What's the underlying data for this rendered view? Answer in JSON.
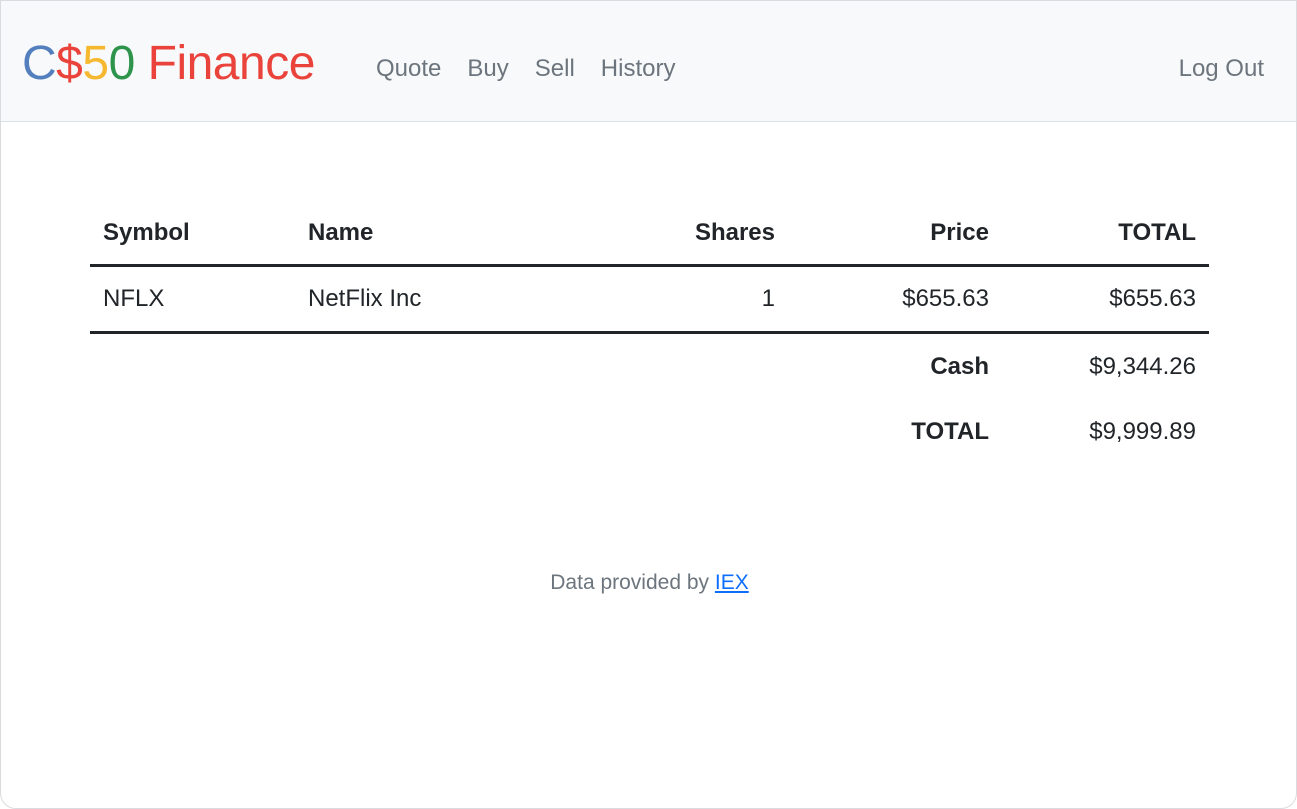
{
  "brand": {
    "parts": [
      {
        "text": "C",
        "color": "#537fbe"
      },
      {
        "text": "$",
        "color": "#ea433b"
      },
      {
        "text": "5",
        "color": "#f5b82e"
      },
      {
        "text": "0",
        "color": "#2e944b"
      },
      {
        "text": " Finance",
        "color": "#ea433b"
      }
    ]
  },
  "nav": {
    "links": [
      "Quote",
      "Buy",
      "Sell",
      "History"
    ],
    "logout": "Log Out"
  },
  "table": {
    "headers": [
      "Symbol",
      "Name",
      "Shares",
      "Price",
      "TOTAL"
    ],
    "rows": [
      {
        "symbol": "NFLX",
        "name": "NetFlix Inc",
        "shares": "1",
        "price": "$655.63",
        "total": "$655.63"
      }
    ],
    "cash_label": "Cash",
    "cash_value": "$9,344.26",
    "grand_total_label": "TOTAL",
    "grand_total_value": "$9,999.89"
  },
  "footer": {
    "text": "Data provided by",
    "link_label": "IEX"
  },
  "colors": {
    "navbar_bg": "#f8f9fa",
    "nav_link": "#6c757d",
    "link": "#0d6efd"
  }
}
